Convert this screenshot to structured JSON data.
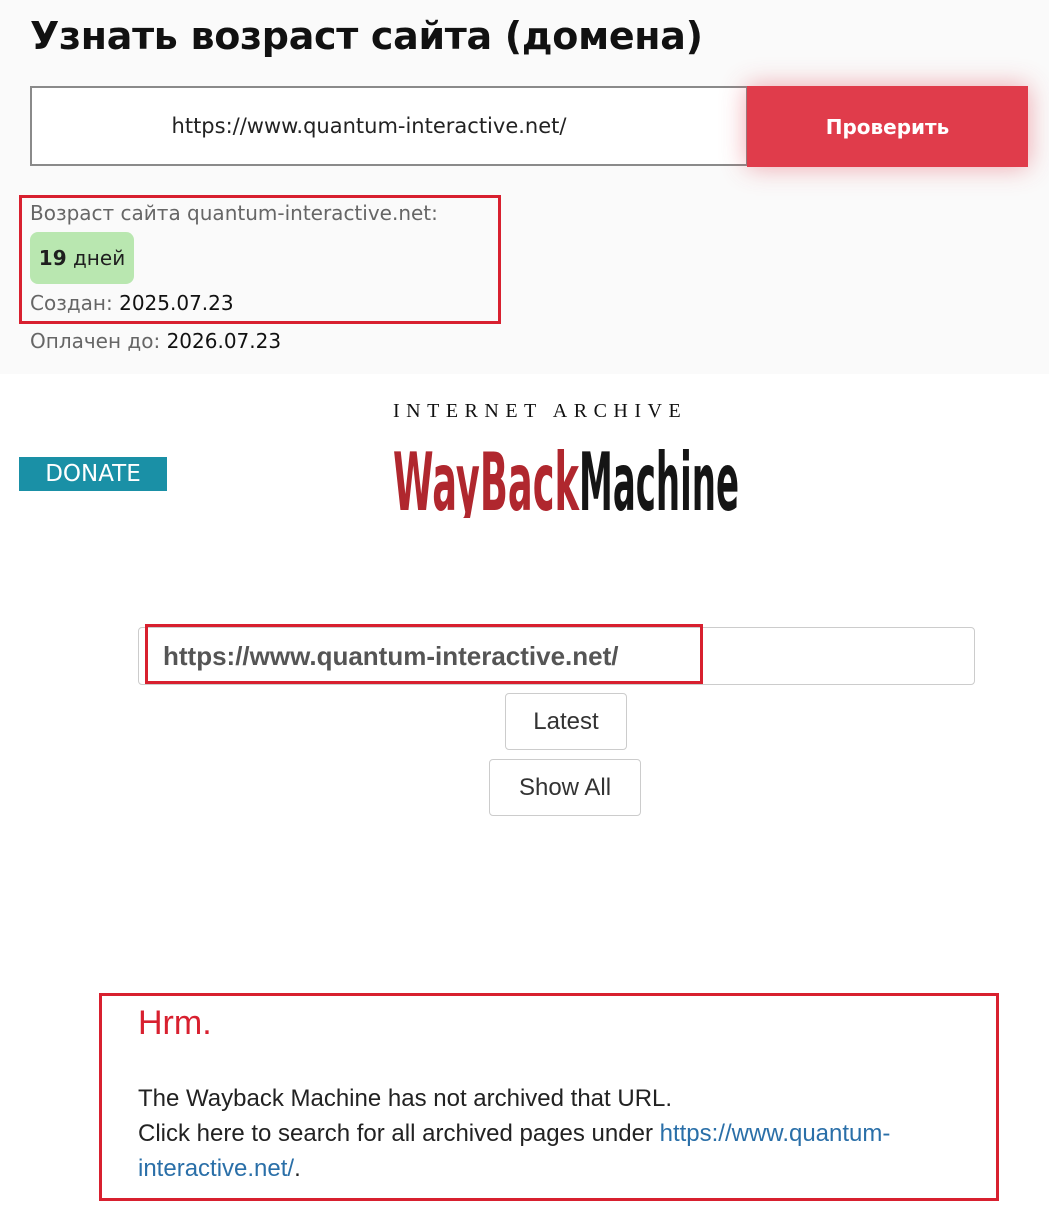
{
  "checker": {
    "title": "Узнать возраст сайта (домена)",
    "url_value": "https://www.quantum-interactive.net/",
    "check_button_label": "Проверить",
    "result_label": "Возраст сайта quantum-interactive.net:",
    "age_number": "19",
    "age_unit": " дней",
    "created_label": "Создан: ",
    "created_value": "2025.07.23",
    "paid_label": "Оплачен до: ",
    "paid_value": "2026.07.23",
    "accent_color": "#e03c4b",
    "badge_color": "#b9e7b0"
  },
  "wayback": {
    "donate_label": "DONATE",
    "logo_top_text": "INTERNET ARCHIVE",
    "logo_word_left": "WayBack",
    "logo_word_right": "Machine",
    "search_value": "https://www.quantum-interactive.net/",
    "latest_label": "Latest",
    "show_all_label": "Show All",
    "hrm_title": "Hrm.",
    "message_line1": "The Wayback Machine has not archived that URL.",
    "message_line2_prefix": "Click here to search for all archived pages under ",
    "message_link": "https://www.quantum-interactive.net/",
    "message_line2_suffix": ".",
    "donate_color": "#1a90a6",
    "highlight_color": "#d8202f",
    "link_color": "#2a6fa8"
  }
}
